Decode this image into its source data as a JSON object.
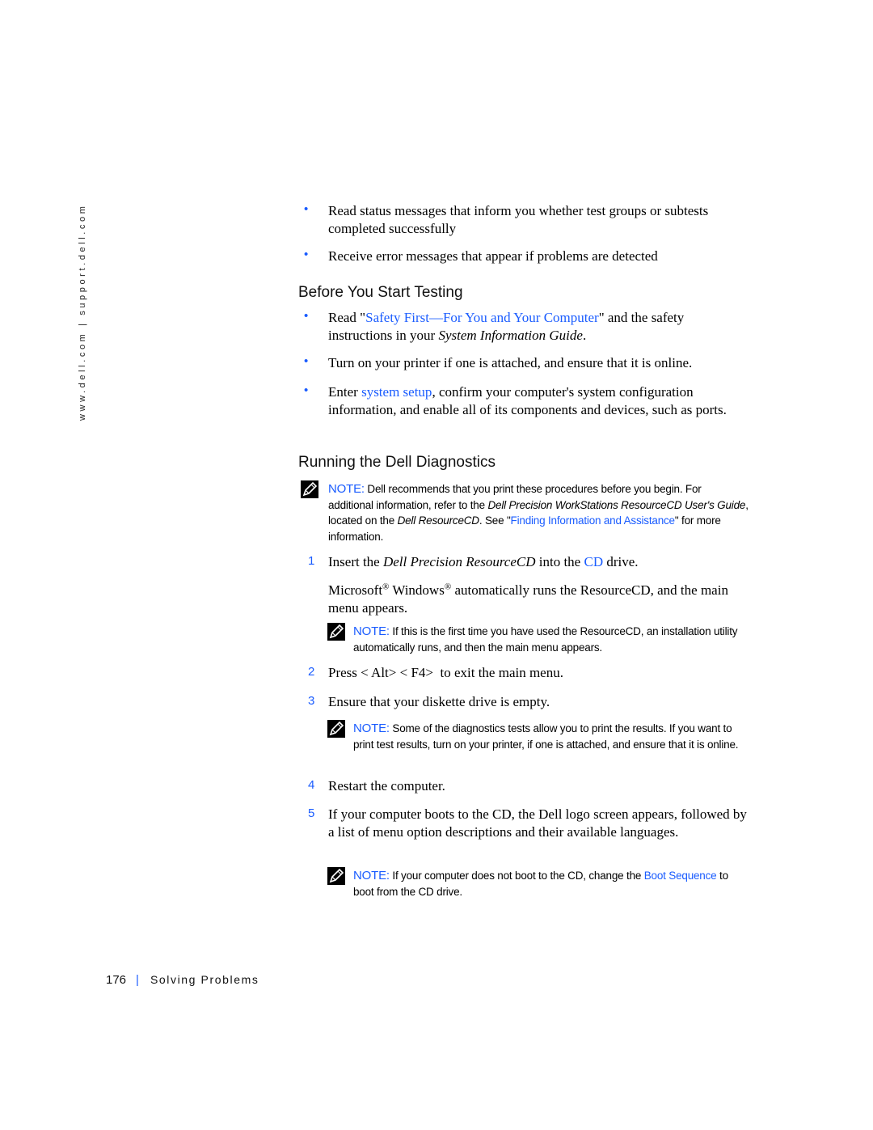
{
  "sidebar": {
    "url_text": "www.dell.com | support.dell.com"
  },
  "intro_bullets": [
    {
      "text": "Read status messages that inform you whether test groups or subtests completed successfully"
    },
    {
      "text": "Receive error messages that appear if problems are detected"
    }
  ],
  "before_testing": {
    "heading": "Before You Start Testing",
    "bullet1": {
      "pre": "Read \"",
      "link": "Safety First—For You and Your Computer",
      "mid": "\" and the safety instructions in your ",
      "italic": "System Information Guide",
      "post": "."
    },
    "bullet2": {
      "text": "Turn on your printer if one is attached, and ensure that it is online."
    },
    "bullet3": {
      "pre": "Enter ",
      "link": "system setup",
      "post": ", confirm your computer's system configuration information, and enable all of its components and devices, such as ports."
    }
  },
  "running": {
    "heading": "Running the Dell Diagnostics",
    "note1": {
      "label": "NOTE:",
      "t1": " Dell recommends that you print these procedures before you begin. For additional information, refer to the ",
      "i1": "Dell Precision WorkStations ResourceCD User's Guide",
      "t2": ", located on the ",
      "i2": "Dell ResourceCD",
      "t3": ". See \"",
      "link": "Finding Information and Assistance",
      "t4": "\" for more information."
    },
    "step1": {
      "num": "1",
      "pre": "Insert the ",
      "italic": "Dell Precision ResourceCD",
      "mid": " into the ",
      "link": "CD",
      "post": " drive."
    },
    "step1_para": {
      "w1": "Microsoft",
      "reg": "®",
      "w2": " Windows",
      "rest": " automatically runs the ResourceCD, and the main menu appears."
    },
    "note2": {
      "label": "NOTE:",
      "text": " If this is the first time you have used the ResourceCD, an installation utility automatically runs, and then the main menu appears."
    },
    "step2": {
      "num": "2",
      "text": "Press < Alt> < F4>  to exit the main menu."
    },
    "step3": {
      "num": "3",
      "text": "Ensure that your diskette drive is empty."
    },
    "note3": {
      "label": "NOTE:",
      "text": " Some of the diagnostics tests allow you to print the results. If you want to print test results, turn on your printer, if one is attached, and ensure that it is online."
    },
    "step4": {
      "num": "4",
      "text": "Restart the computer."
    },
    "step5": {
      "num": "5",
      "text": "If your computer boots to the CD, the Dell logo screen appears, followed by a list of menu option descriptions and their available languages."
    },
    "note4": {
      "label": "NOTE:",
      "t1": " If your computer does not boot to the CD, change the ",
      "link": "Boot Sequence",
      "t2": " to boot from the CD drive."
    }
  },
  "footer": {
    "page_number": "176",
    "separator": "|",
    "section": "Solving Problems"
  },
  "icons": {
    "bullet": "bullet-dot-icon",
    "note": "pencil-note-icon"
  },
  "colors": {
    "accent_blue": "#1a5cff",
    "text": "#000000"
  }
}
